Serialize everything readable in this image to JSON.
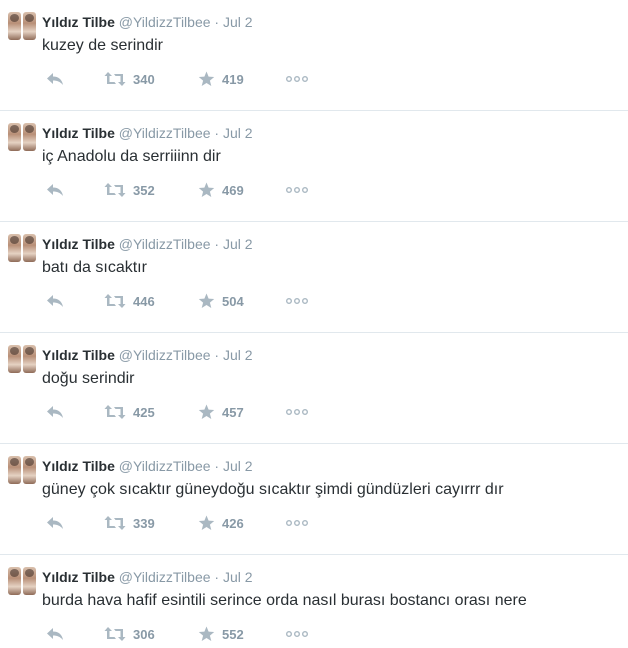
{
  "author": {
    "name": "Yıldız Tilbe",
    "handle": "@YildizzTilbee",
    "separator": "·"
  },
  "colors": {
    "text": "#292f33",
    "meta": "#8899a6",
    "icon": "#aab8c2",
    "divider": "#e1e8ed"
  },
  "icons": {
    "reply": "reply-arrow-icon",
    "retweet": "retweet-icon",
    "favorite": "star-icon",
    "more": "more-dots-icon"
  },
  "tweets": [
    {
      "date": "Jul 2",
      "text": "kuzey de serindir",
      "retweets": "340",
      "favorites": "419"
    },
    {
      "date": "Jul 2",
      "text": "iç Anadolu da serriiinn dir",
      "retweets": "352",
      "favorites": "469"
    },
    {
      "date": "Jul 2",
      "text": "batı da sıcaktır",
      "retweets": "446",
      "favorites": "504"
    },
    {
      "date": "Jul 2",
      "text": "doğu serindir",
      "retweets": "425",
      "favorites": "457"
    },
    {
      "date": "Jul 2",
      "text": "güney  çok sıcaktır güneydoğu sıcaktır şimdi gündüzleri cayırrr dır",
      "retweets": "339",
      "favorites": "426"
    },
    {
      "date": "Jul 2",
      "text": "burda hava hafif esintili serince orda nasıl  burası bostancı orası nere",
      "retweets": "306",
      "favorites": "552"
    }
  ]
}
